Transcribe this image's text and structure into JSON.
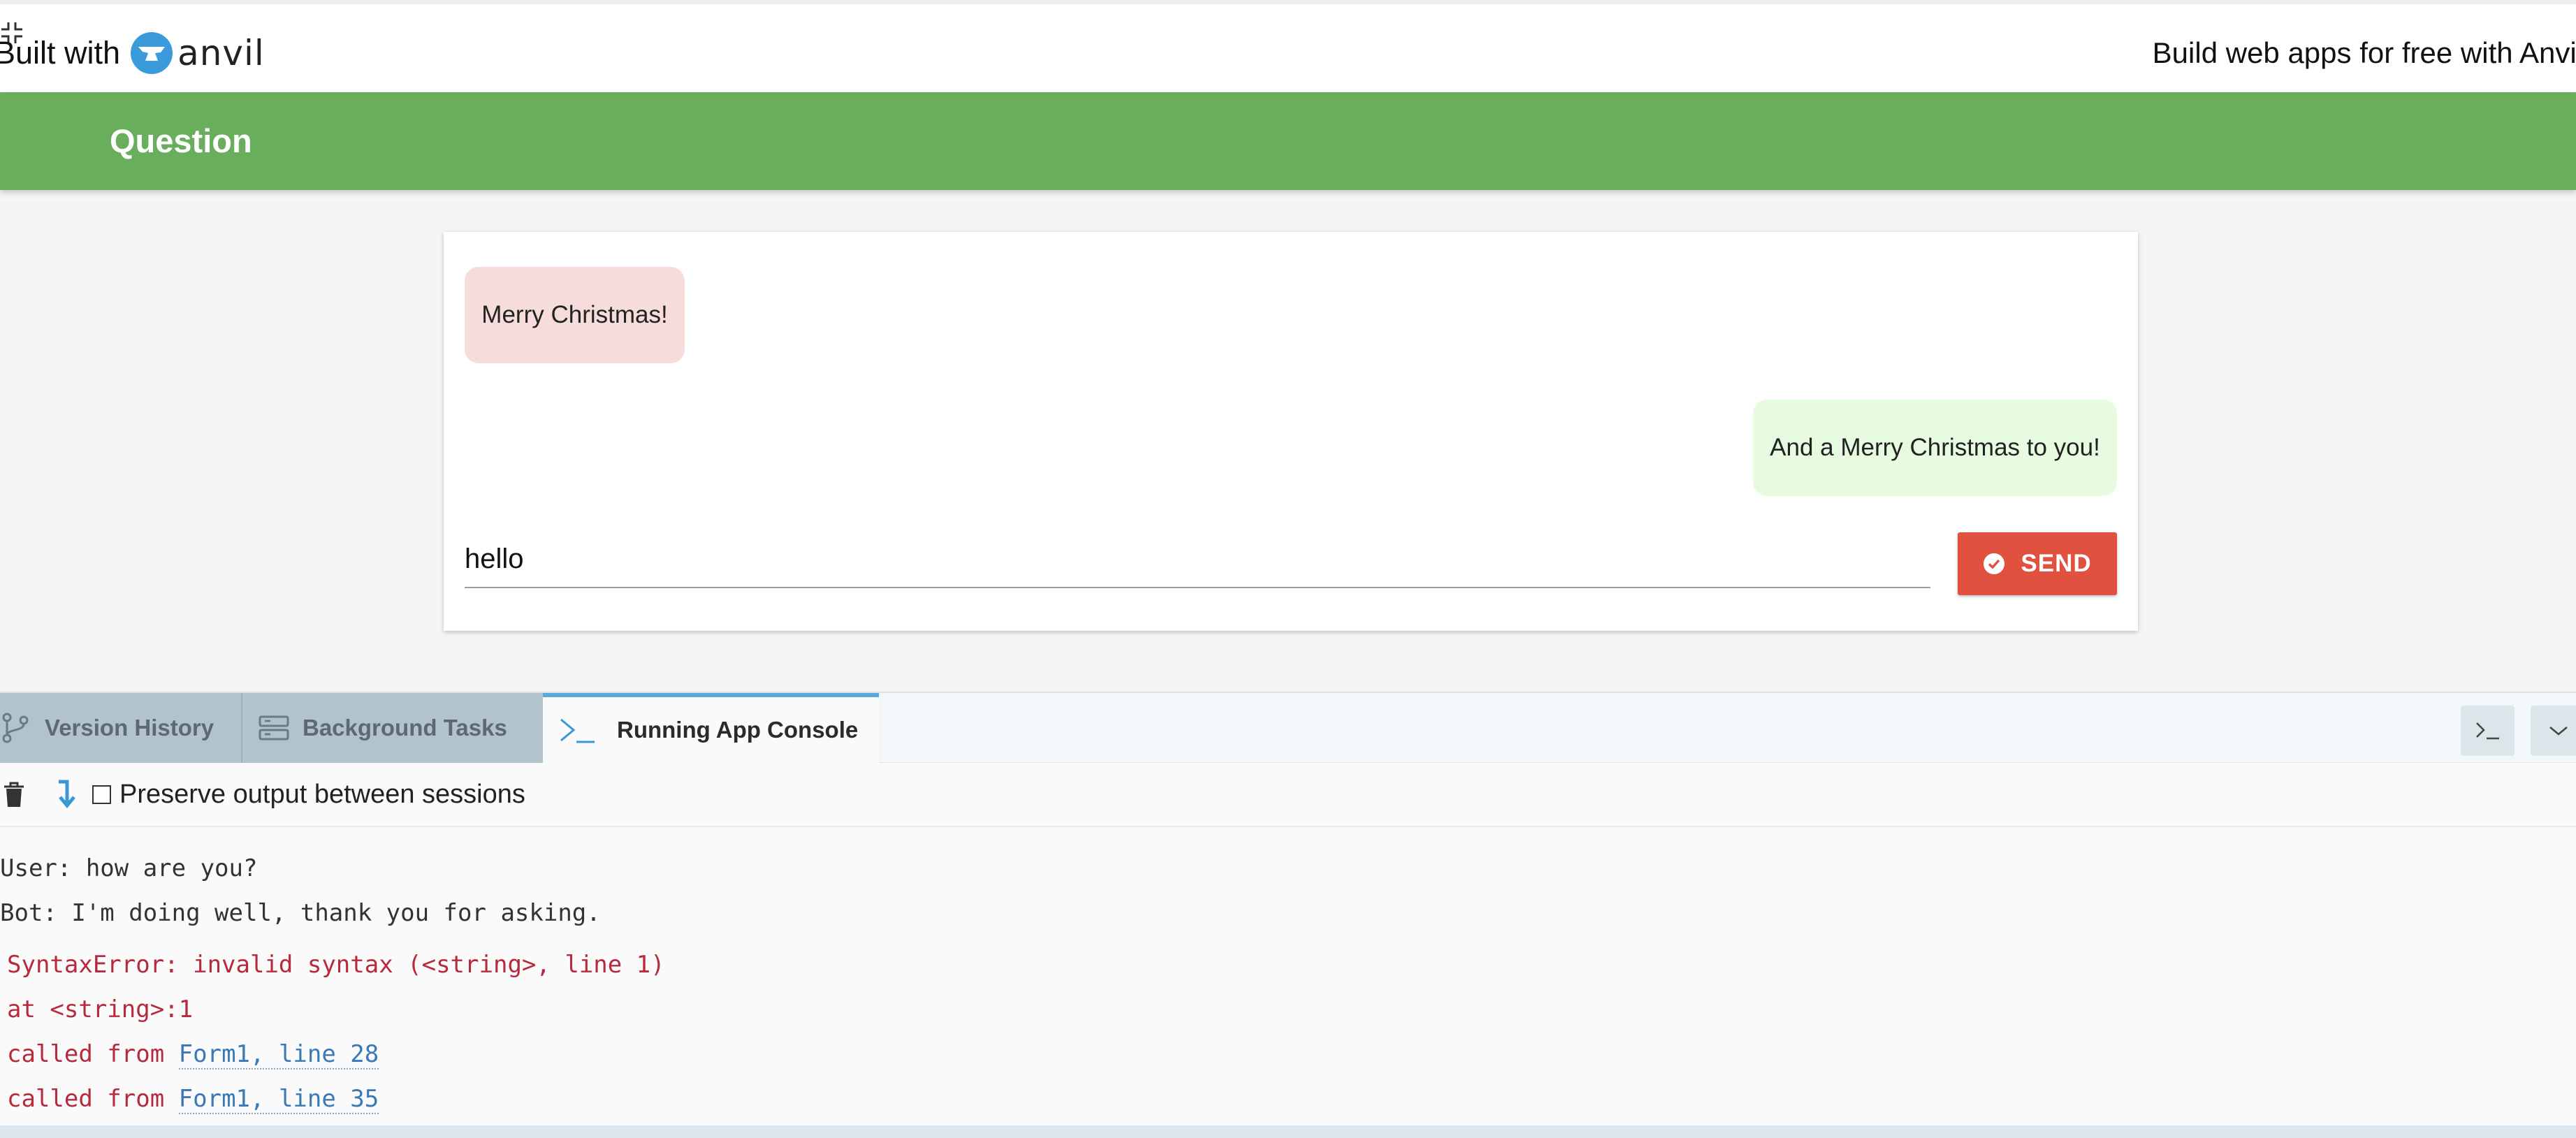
{
  "banner": {
    "built_with": "Built with",
    "brand": "anvil",
    "cta": "Build web apps for free with Anvil"
  },
  "app": {
    "title": "Question"
  },
  "chat": {
    "bot_message": "Merry Christmas!",
    "user_message": "And a Merry Christmas to you!",
    "input_value": "hello",
    "send_label": "SEND"
  },
  "panel": {
    "tabs": [
      {
        "label": "Version History"
      },
      {
        "label": "Background Tasks"
      },
      {
        "label": "Running App Console"
      }
    ],
    "preserve_label": "Preserve output between sessions",
    "logs": [
      "User: how are you?",
      "Bot: I'm doing well, thank you for asking."
    ],
    "error": {
      "message": "SyntaxError: invalid syntax (<string>, line 1)",
      "at": "at <string>:1",
      "called_from_1": "called from",
      "link_1": "Form1, line 28",
      "called_from_2": "called from",
      "link_2": "Form1, line 35"
    }
  },
  "colors": {
    "header_green": "#69ae5d",
    "send_red": "#e0513f",
    "bot_bubble": "#f7dcdc",
    "user_bubble": "#e6fbe0",
    "error_text": "#b52a3d",
    "link": "#3b78b8",
    "active_tab_accent": "#5aa9dc"
  }
}
